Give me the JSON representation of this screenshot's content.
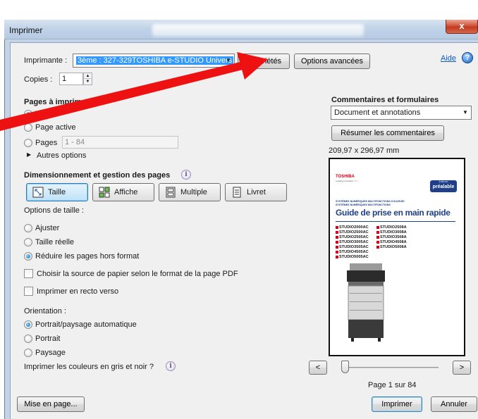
{
  "window": {
    "title": "Imprimer",
    "close": "x"
  },
  "printer": {
    "label": "Imprimante :",
    "selected": "3ème : 327-329TOSHIBA e-STUDIO Univers",
    "properties_button": "Propriétés",
    "advanced_button": "Options avancées",
    "help_link": "Aide",
    "copies_label": "Copies :",
    "copies_value": "1"
  },
  "pages": {
    "heading": "Pages à imprimer",
    "all": "Tout",
    "current": "Page active",
    "range_label": "Pages",
    "range_value": "1 - 84",
    "more": "Autres options"
  },
  "sizing": {
    "heading": "Dimensionnement et gestion des pages",
    "buttons": [
      "Taille",
      "Affiche",
      "Multiple",
      "Livret"
    ],
    "options_label": "Options de taille :",
    "fit": "Ajuster",
    "actual": "Taille réelle",
    "shrink": "Réduire les pages hors format",
    "paper_source": "Choisir la source de papier selon le format de la page PDF",
    "duplex": "Imprimer en recto verso"
  },
  "orientation": {
    "label": "Orientation :",
    "auto": "Portrait/paysage automatique",
    "portrait": "Portrait",
    "landscape": "Paysage",
    "grayscale": "Imprimer les couleurs en gris et noir ?"
  },
  "comments": {
    "heading": "Commentaires et formulaires",
    "selected": "Document et annotations",
    "summarize_button": "Résumer les commentaires",
    "dimensions": "209,97 x 296,97 mm"
  },
  "preview": {
    "brand": "TOSHIBA",
    "tagline": "Leading Innovation >>>",
    "badge_small": "À lire en",
    "badge": "préalable",
    "subtitle1": "SYSTÈMES NUMÉRIQUES MULTIFONCTIONS COULEUR/",
    "subtitle2": "SYSTÈMES NUMÉRIQUES MULTIFONCTIONS",
    "title": "Guide de prise en main rapide",
    "models_left": [
      "STUDIO2000AC",
      "STUDIO2500AC",
      "STUDIO2505AC",
      "STUDIO3005AC",
      "STUDIO3505AC",
      "STUDIO4505AC",
      "STUDIO5005AC"
    ],
    "models_right": [
      "STUDIO2508A",
      "STUDIO3008A",
      "STUDIO3508A",
      "STUDIO4508A",
      "STUDIO5008A"
    ],
    "page_indicator": "Page 1 sur 84",
    "prev": "<",
    "next": ">"
  },
  "footer": {
    "page_setup": "Mise en page...",
    "print": "Imprimer",
    "cancel": "Annuler"
  },
  "colors": {
    "accent": "#3399ff",
    "arrow": "#ee1111",
    "title_blue": "#1f3f8a",
    "brand_red": "#d6001c"
  }
}
